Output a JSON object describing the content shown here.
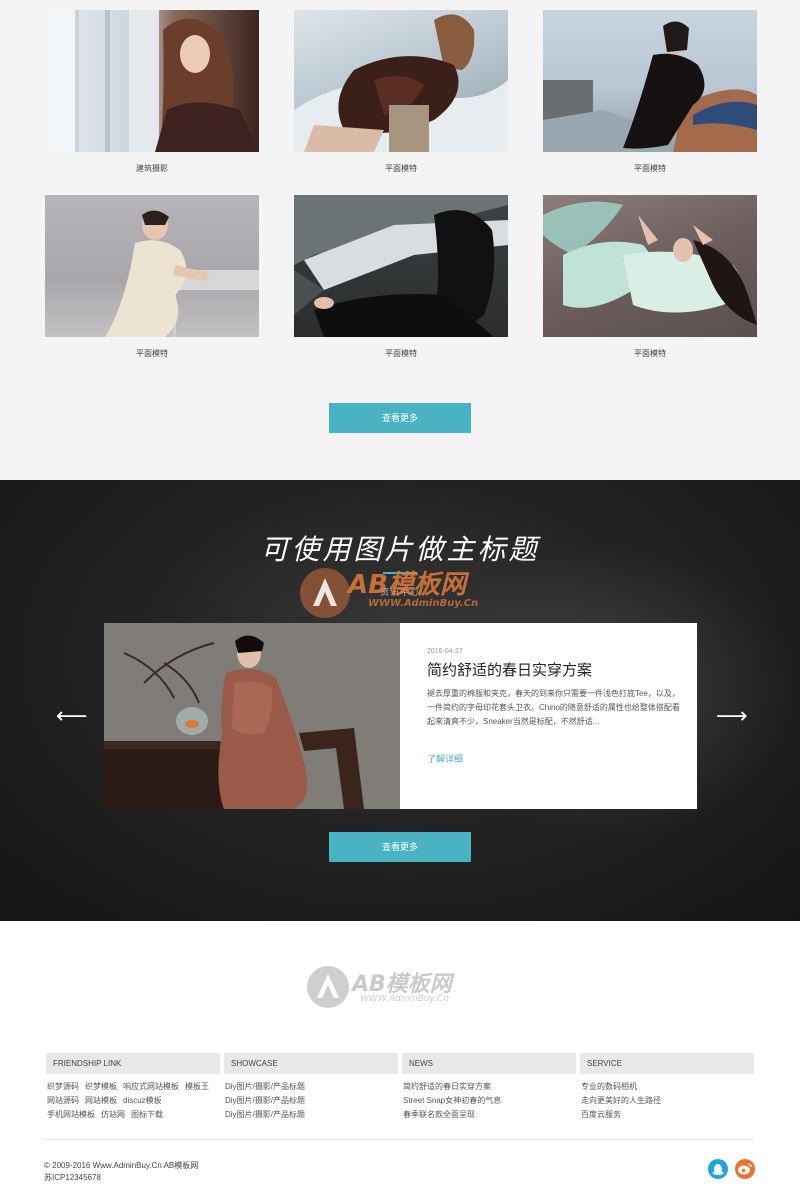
{
  "gallery": {
    "items": [
      {
        "caption": "建筑摄影"
      },
      {
        "caption": "平面模特"
      },
      {
        "caption": "平面模特"
      },
      {
        "caption": "平面模特"
      },
      {
        "caption": "平面模特"
      },
      {
        "caption": "平面模特"
      }
    ],
    "more_label": "查看更多"
  },
  "featured": {
    "title": "可使用图片做主标题",
    "subtitle": "资讯中心",
    "watermark": {
      "text": "AB模板网",
      "url": "WWW.AdminBuy.Cn"
    },
    "slide": {
      "date": "2016-04-27",
      "title": "简约舒适的春日实穿方案",
      "text": "褪去厚重的棉服和夹克，春天的到来你只需要一件浅色打底Tee，以及，一件简约的字母印花套头卫衣。Chino的随意舒适的属性也给整体搭配看起来清爽不少，Sneaker当然是标配，不然舒适...",
      "link": "了解详细"
    },
    "more_label": "查看更多",
    "arrow_left": "⟵",
    "arrow_right": "⟶"
  },
  "footer": {
    "logo": {
      "text": "AB模板网",
      "url": "WWW.AdminBuy.Cn"
    },
    "columns": [
      {
        "head": "FRIENDSHIP LINK",
        "links": [
          "织梦源码",
          "织梦模板",
          "响应式网站模板",
          "模板王",
          "网站源码",
          "网站模板",
          "discuz模板",
          "手机网站模板",
          "仿站网",
          "图标下载"
        ]
      },
      {
        "head": "SHOWCASE",
        "links": [
          "Diy图片/摄影/产品标题",
          "Diy图片/摄影/产品标题",
          "Diy图片/摄影/产品标题"
        ]
      },
      {
        "head": "NEWS",
        "links": [
          "简约舒适的春日实穿方案",
          "Street Snap女神初春的气息",
          "春季联名款全面呈现"
        ]
      },
      {
        "head": "SERVICE",
        "links": [
          "专业的数码相机",
          "走向更美好的人生路径",
          "百度云服务"
        ]
      }
    ],
    "copyright": "© 2009-2016 Www.AdminBuy.Cn AB模板网",
    "icp": "苏ICP12345678",
    "social": [
      {
        "icon": "qq-icon",
        "color": "#1ea4e0"
      },
      {
        "icon": "weibo-icon",
        "color": "#f2702f"
      }
    ]
  },
  "colors": {
    "accent": "#4ab3c3",
    "dark_bg": "#1e1e1e",
    "light_bg": "#f4f4f4"
  }
}
